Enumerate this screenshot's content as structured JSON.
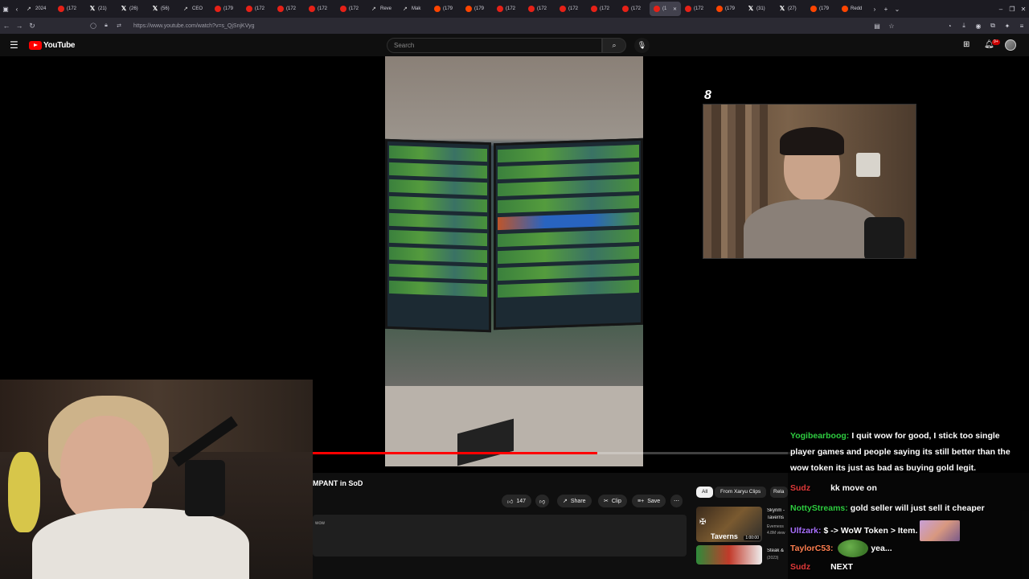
{
  "browser": {
    "tabs": [
      {
        "label": "2024",
        "icon": "chart-icon"
      },
      {
        "label": "(172",
        "icon": "youtube-icon"
      },
      {
        "label": "(21)",
        "icon": "x-icon"
      },
      {
        "label": "(26)",
        "icon": "x-icon"
      },
      {
        "label": "(56)",
        "icon": "x-icon"
      },
      {
        "label": "CEO",
        "icon": "chart-icon"
      },
      {
        "label": "(179",
        "icon": "youtube-icon"
      },
      {
        "label": "(172",
        "icon": "youtube-icon"
      },
      {
        "label": "(172",
        "icon": "youtube-icon"
      },
      {
        "label": "(172",
        "icon": "youtube-icon"
      },
      {
        "label": "(172",
        "icon": "youtube-icon"
      },
      {
        "label": "Reve",
        "icon": "chart-icon"
      },
      {
        "label": "Mak",
        "icon": "chart-icon"
      },
      {
        "label": "(179",
        "icon": "reddit-icon"
      },
      {
        "label": "(179",
        "icon": "reddit-icon"
      },
      {
        "label": "(172",
        "icon": "youtube-icon"
      },
      {
        "label": "(172",
        "icon": "youtube-icon"
      },
      {
        "label": "(172",
        "icon": "youtube-icon"
      },
      {
        "label": "(172",
        "icon": "youtube-icon"
      },
      {
        "label": "(172",
        "icon": "youtube-icon"
      },
      {
        "label": "(1",
        "icon": "youtube-icon",
        "active": true
      },
      {
        "label": "(172",
        "icon": "youtube-icon"
      },
      {
        "label": "(179",
        "icon": "reddit-icon"
      },
      {
        "label": "(31)",
        "icon": "x-icon"
      },
      {
        "label": "(27)",
        "icon": "x-icon"
      },
      {
        "label": "(179",
        "icon": "reddit-icon"
      },
      {
        "label": "Redd",
        "icon": "reddit-icon"
      }
    ],
    "url": "https://www.youtube.com/watch?v=s_QjSnjKVyg"
  },
  "youtube": {
    "logo_text": "YouTube",
    "search_placeholder": "Search",
    "notification_count": "9+"
  },
  "player": {
    "progress_fraction": 0.59,
    "overlay_number": "8"
  },
  "video": {
    "title": "MPANT in SoD",
    "likes": "147",
    "share_label": "Share",
    "clip_label": "Clip",
    "save_label": "Save",
    "more_label": "⋯",
    "description_snippet": "wow"
  },
  "recommendations": {
    "chips": [
      "All",
      "From Xaryu Clips",
      "Rela"
    ],
    "items": [
      {
        "title": "Skyrim -",
        "subtitle": "Taverns",
        "meta1": "Everness",
        "meta2": "4.8M view",
        "thumb_text": "Taverns",
        "duration": "1:00:00"
      },
      {
        "title": "Steak &",
        "subtitle": "(2023)",
        "meta1": "",
        "meta2": "",
        "thumb_text": "",
        "duration": ""
      }
    ]
  },
  "chat": {
    "messages": [
      {
        "user": "Yogibearboog:",
        "text": "I quit wow for good, I stick too single player games and people saying its still better than the wow token its just as bad as buying gold legit.",
        "color": "#2ecc40"
      },
      {
        "user": "Sudz",
        "text": "kk move on",
        "color": "#e03a3a"
      },
      {
        "user": "NottyStreams:",
        "text": "gold seller will just sell it cheaper",
        "color": "#2ecc40"
      },
      {
        "user": "Ulfzark:",
        "text": "$ -> WoW Token > Item.",
        "color": "#a970ff"
      },
      {
        "user": "TaylorC53:",
        "text": "yea...",
        "color": "#ff7f50"
      },
      {
        "user": "Sudz",
        "text": "NEXT",
        "color": "#e03a3a"
      }
    ]
  }
}
